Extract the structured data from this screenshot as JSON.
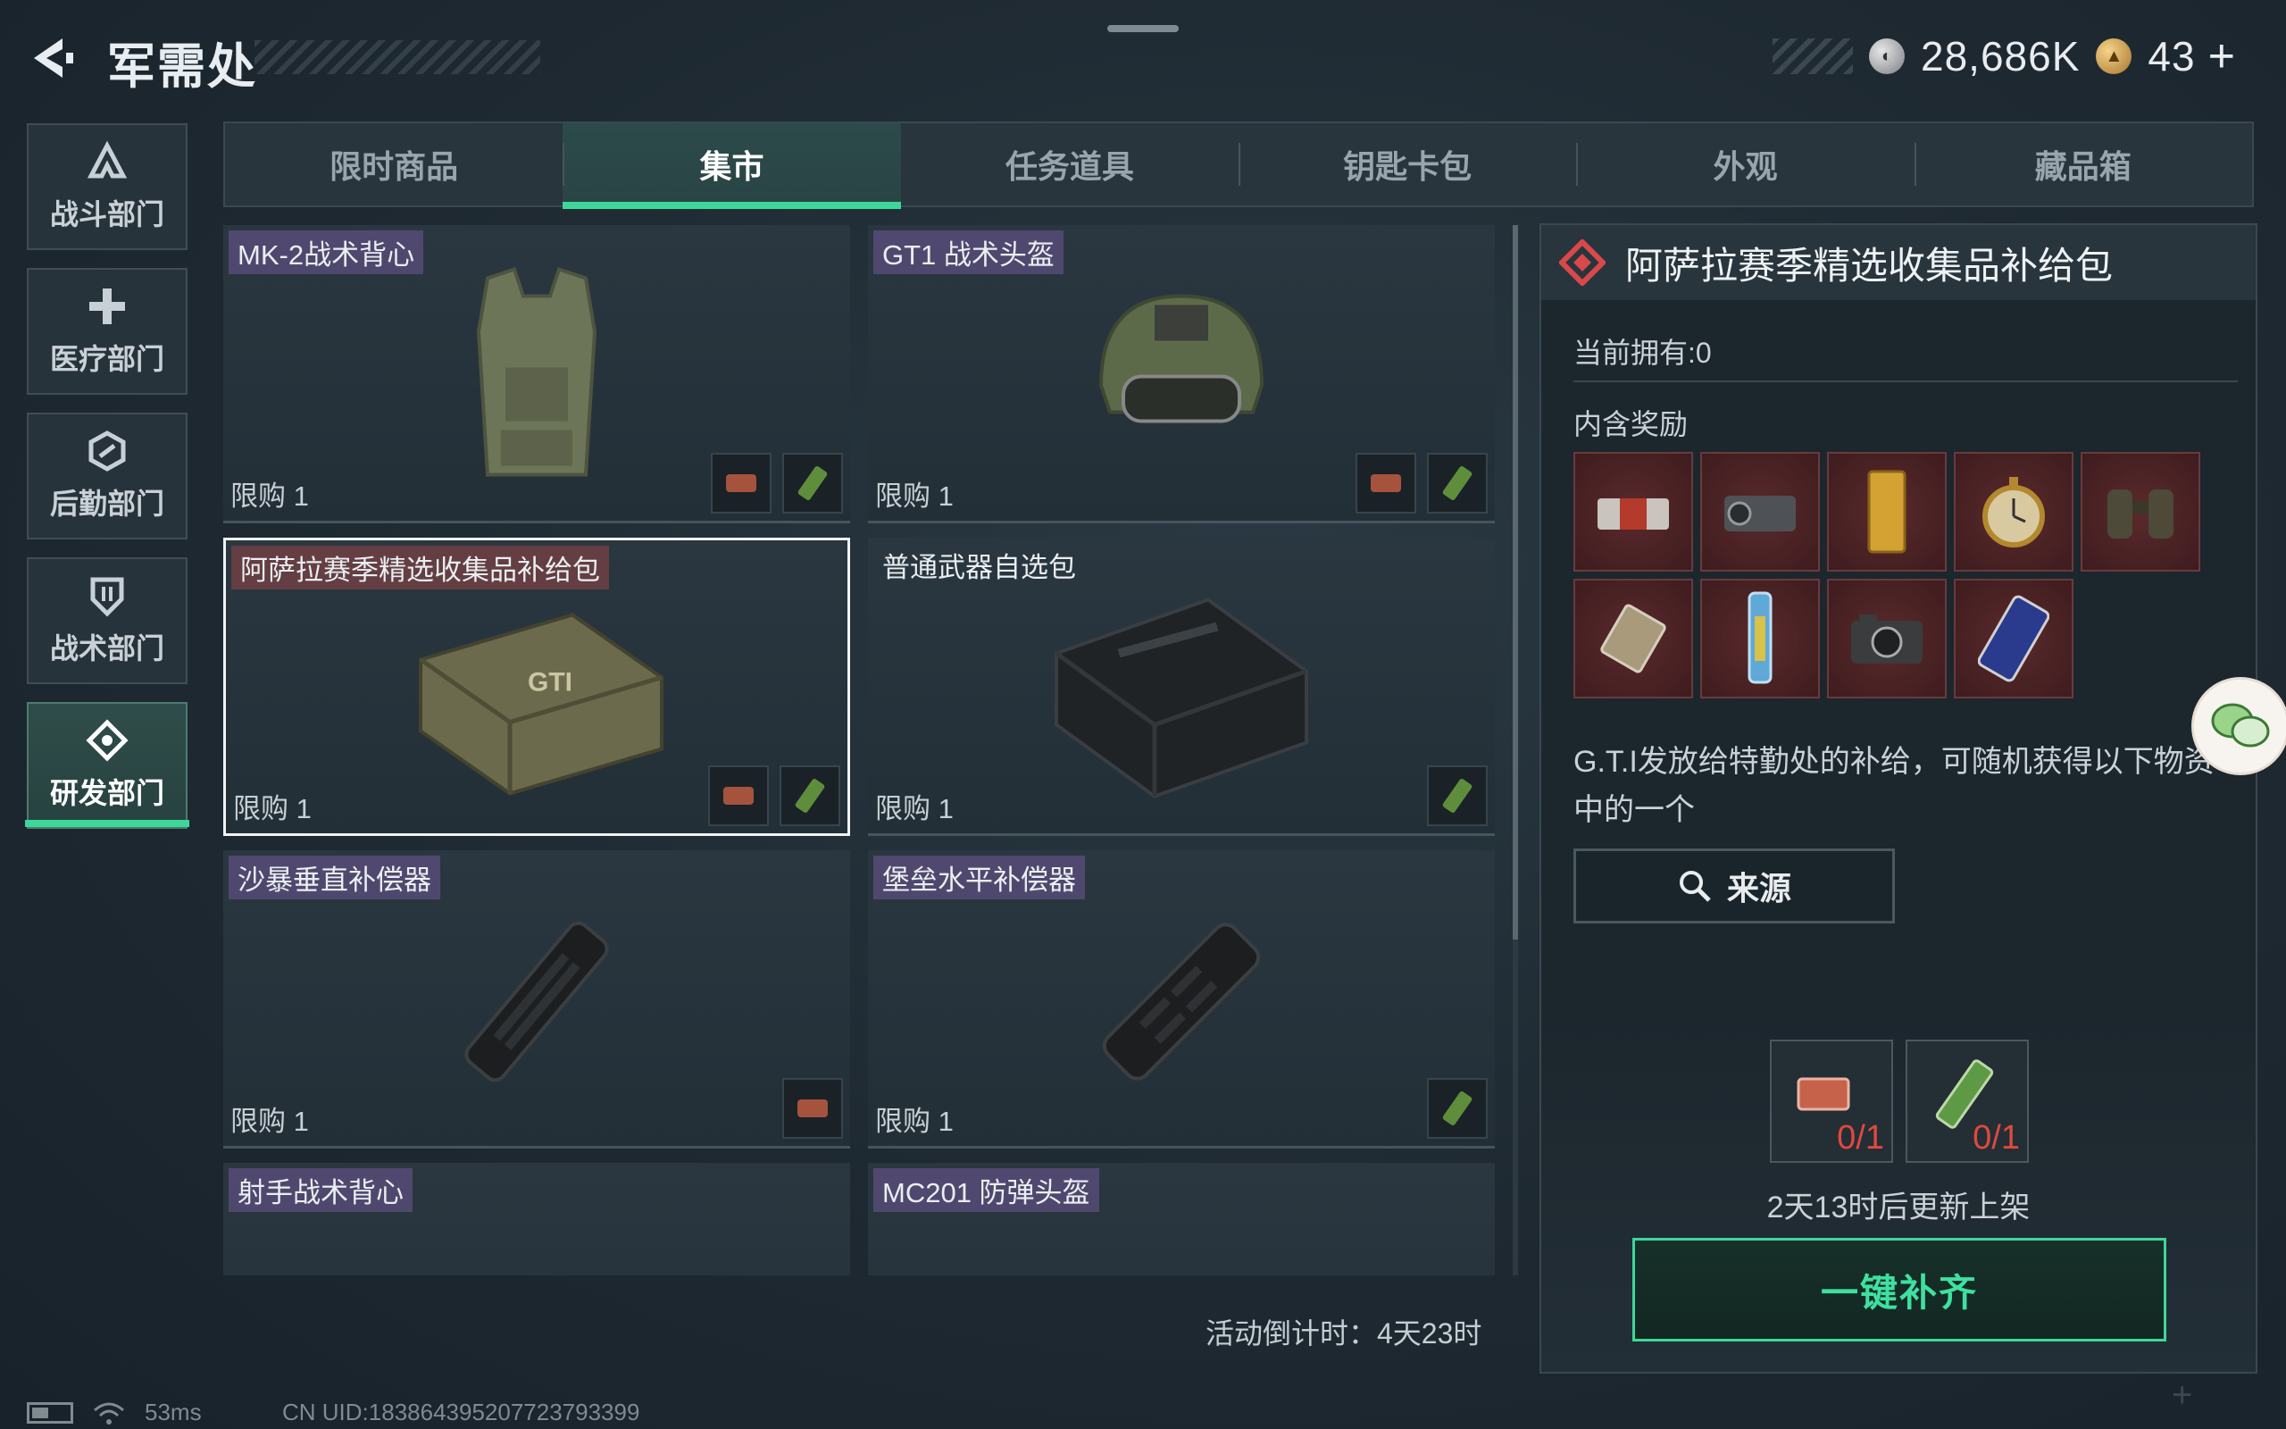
{
  "header": {
    "title": "军需处",
    "currency": [
      {
        "icon": "silver-coin-icon",
        "value": "28,686K"
      },
      {
        "icon": "gold-coin-icon",
        "value": "43"
      }
    ],
    "add_label": "+"
  },
  "sidebar": {
    "items": [
      {
        "label": "战斗部门",
        "icon": "combat-icon"
      },
      {
        "label": "医疗部门",
        "icon": "medical-cross-icon"
      },
      {
        "label": "后勤部门",
        "icon": "logistics-icon"
      },
      {
        "label": "战术部门",
        "icon": "shield-icon"
      },
      {
        "label": "研发部门",
        "icon": "research-icon",
        "active": true
      }
    ]
  },
  "tabs": [
    {
      "label": "限时商品"
    },
    {
      "label": "集市",
      "active": true
    },
    {
      "label": "任务道具"
    },
    {
      "label": "钥匙卡包"
    },
    {
      "label": "外观"
    },
    {
      "label": "藏品箱"
    }
  ],
  "items": [
    {
      "name": "MK-2战术背心",
      "limit": "限购 1",
      "badges": [
        "red",
        "green"
      ]
    },
    {
      "name": "GT1 战术头盔",
      "limit": "限购 1",
      "badges": [
        "red",
        "green"
      ]
    },
    {
      "name": "阿萨拉赛季精选收集品补给包",
      "limit": "限购 1",
      "badges": [
        "red",
        "green"
      ],
      "selected": true
    },
    {
      "name": "普通武器自选包",
      "limit": "限购 1",
      "badges": [
        "green"
      ]
    },
    {
      "name": "沙暴垂直补偿器",
      "limit": "限购 1",
      "badges": [
        "red"
      ]
    },
    {
      "name": "堡垒水平补偿器",
      "limit": "限购 1",
      "badges": [
        "green"
      ]
    },
    {
      "name": "射手战术背心",
      "limit": "",
      "badges": []
    },
    {
      "name": "MC201 防弹头盔",
      "limit": "",
      "badges": []
    }
  ],
  "countdown": "活动倒计时：4天23时",
  "detail": {
    "title": "阿萨拉赛季精选收集品补给包",
    "owned": "当前拥有:0",
    "rewards_label": "内含奖励",
    "rewards": [
      "cigar-box-icon",
      "projector-icon",
      "gold-bar-icon",
      "pocket-watch-icon",
      "binoculars-icon",
      "tablet-card-icon",
      "ampoule-icon",
      "camera-icon",
      "smartphone-icon"
    ],
    "description": "G.T.I发放给特勤处的补给，可随机获得以下物资中的一个",
    "source_label": "来源",
    "materials": [
      {
        "icon": "red-material-icon",
        "count": "0/1"
      },
      {
        "icon": "green-material-icon",
        "count": "0/1"
      }
    ],
    "restock": "2天13时后更新上架",
    "fill_button": "一键补齐"
  },
  "status": {
    "ping": "53ms",
    "uid": "CN UID:18386439520772379339​9"
  },
  "colors": {
    "accent": "#3dd79a",
    "warning": "#e0493c",
    "background": "#1f2a32"
  }
}
